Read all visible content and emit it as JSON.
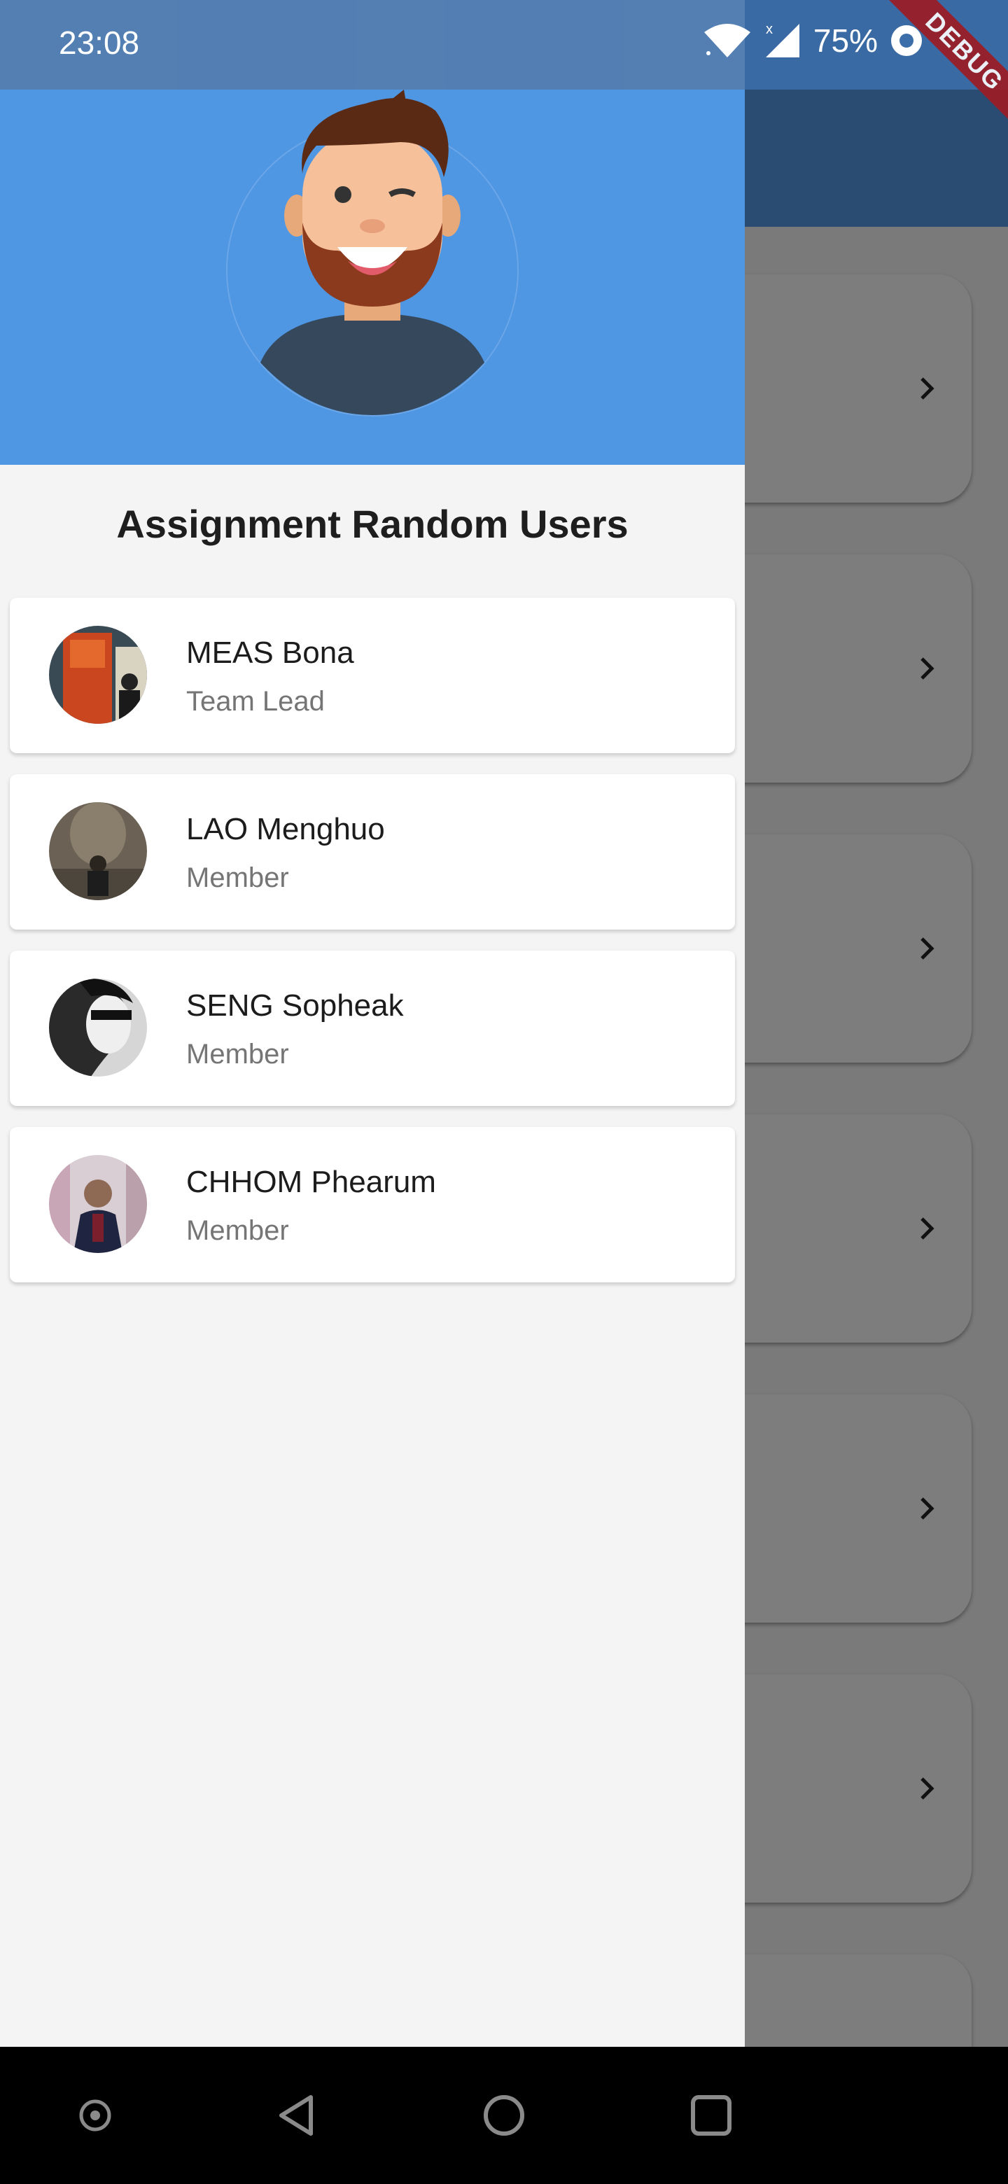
{
  "status_bar": {
    "time": "23:08",
    "battery": "75%",
    "icons": [
      "wifi-icon",
      "signal-icon",
      "battery-icon"
    ]
  },
  "debug_banner": {
    "label": "DEBUG"
  },
  "drawer": {
    "title": "Assignment Random Users",
    "header_color": "#4f96e3",
    "members": [
      {
        "name": "MEAS Bona",
        "role": "Team Lead"
      },
      {
        "name": "LAO Menghuo",
        "role": "Member"
      },
      {
        "name": "SENG Sopheak",
        "role": "Member"
      },
      {
        "name": "CHHOM Phearum",
        "role": "Member"
      }
    ]
  },
  "background_list": {
    "card_count": 7,
    "chevron_icon": "chevron-right-icon"
  },
  "nav_bar": {
    "buttons": [
      "assistant-icon",
      "back-icon",
      "home-icon",
      "recents-icon"
    ]
  }
}
